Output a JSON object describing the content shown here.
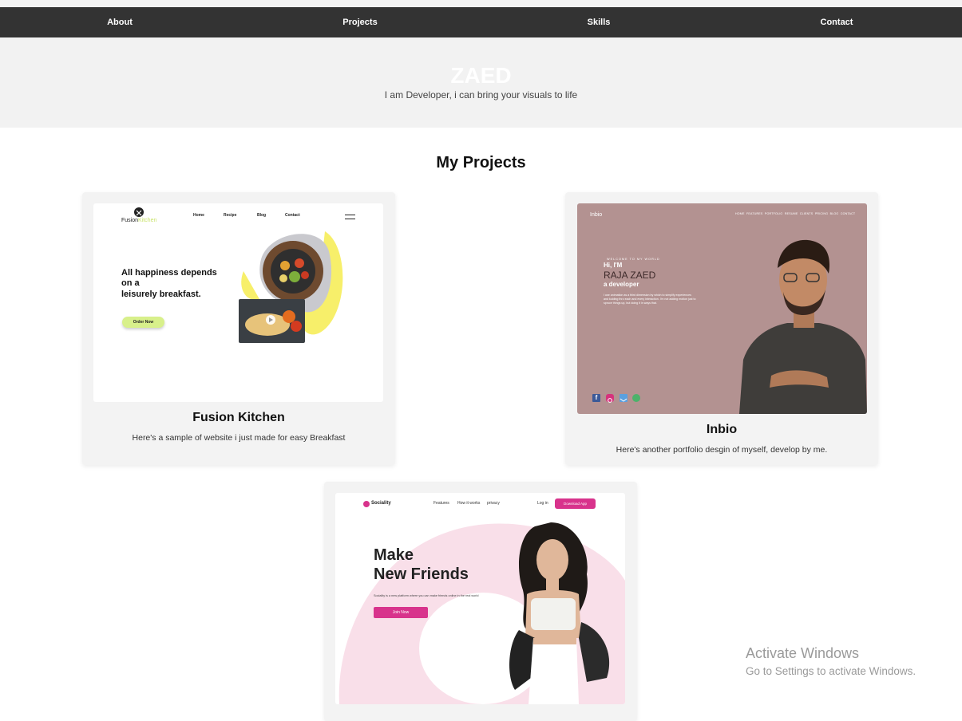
{
  "nav": {
    "items": [
      "About",
      "Projects",
      "Skills",
      "Contact"
    ]
  },
  "hero": {
    "name": "ZAED",
    "tagline": "I am Developer, i can bring your visuals to life"
  },
  "projects_section": {
    "title": "My Projects"
  },
  "projects": [
    {
      "title": "Fusion Kitchen",
      "description": "Here's a sample of website i just made for easy Breakfast",
      "preview": {
        "logo_text_1": "Fusion",
        "logo_text_2": "Kitchen",
        "nav": [
          "Home",
          "Recipe",
          "Blog",
          "Contact"
        ],
        "headline_1": "All happiness depends",
        "headline_2": "on a",
        "headline_3": "leisurely breakfast.",
        "cta": "Order Now"
      }
    },
    {
      "title": "Inbio",
      "description": "Here's another portfolio desgin of myself, develop by me.",
      "preview": {
        "logo": "Inbio",
        "nav": [
          "HOME",
          "FEATURES",
          "PORTFOLIO",
          "RESUME",
          "CLIENTS",
          "PRICING",
          "BLOG",
          "CONTACT"
        ],
        "welcome": "WELCOME TO MY WORLD",
        "hi": "Hi, I'M",
        "name": "RAJA ZAED",
        "role": "a developer",
        "body_1": "I use animation as a third dimension by which to simplify experiences",
        "body_2": "and kuiding thro each and every interaction. I'm not adding motion just to",
        "body_3": "spruce things up, but doing it in ways that."
      }
    },
    {
      "title": "",
      "description": "",
      "preview": {
        "logo": "Sociality",
        "nav": [
          "Features",
          "How it works",
          "privacy"
        ],
        "login": "Log in",
        "download": "Download App",
        "headline_1": "Make",
        "headline_2": "New Friends",
        "body": "Sociality is a new platform where you can make friends online in the real world",
        "cta": "Join Now"
      }
    }
  ],
  "watermark": {
    "title": "Activate Windows",
    "subtitle": "Go to Settings to activate Windows."
  },
  "colors": {
    "navbar": "#333333",
    "hero_bg": "#f2f2f2",
    "card_bg": "#f3f3f3",
    "inbio_bg": "#b39291",
    "fusion_cta": "#d8f08b",
    "social_accent": "#d8338c",
    "social_pink": "#f9dfe9"
  }
}
